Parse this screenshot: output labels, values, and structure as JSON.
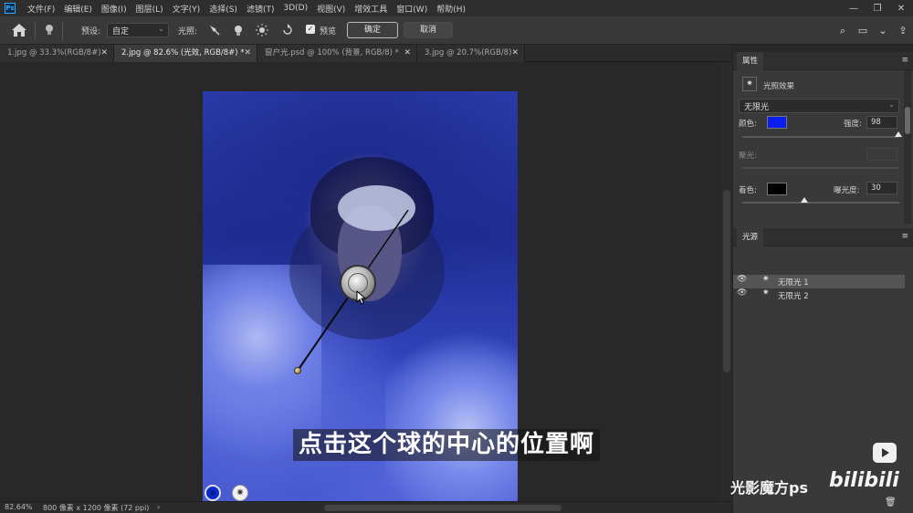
{
  "app": {
    "logo": "Ps"
  },
  "menu": [
    "文件(F)",
    "编辑(E)",
    "图像(I)",
    "图层(L)",
    "文字(Y)",
    "选择(S)",
    "滤镜(T)",
    "3D(D)",
    "视图(V)",
    "增效工具",
    "窗口(W)",
    "帮助(H)"
  ],
  "options": {
    "preset_label": "预设:",
    "preset_value": "自定",
    "light_label": "光照:",
    "preview_label": "预览",
    "preview_checked": true,
    "ok": "确定",
    "cancel": "取消"
  },
  "tabs": [
    {
      "label": "1.jpg @ 33.3%(RGB/8#)",
      "active": false
    },
    {
      "label": "2.jpg @ 82.6% (光效, RGB/8#) *",
      "active": true
    },
    {
      "label": "窗户光.psd @ 100% (背景, RGB/8) *",
      "active": false
    },
    {
      "label": "3.jpg @ 20.7%(RGB/8)",
      "active": false
    }
  ],
  "properties": {
    "tab": "属性",
    "effect_title": "光照效果",
    "light_type": "无限光",
    "color_label": "颜色:",
    "color_value": "#0a1ef0",
    "intensity_label": "强度:",
    "intensity_value": "98",
    "intensity_slider_position": 0.98,
    "hotspot_label": "聚光:",
    "tint_label": "着色:",
    "tint_color": "#000000",
    "exposure_label": "曝光度:",
    "exposure_value": "30",
    "exposure_slider_position": 0.5
  },
  "lights": {
    "tab": "光源",
    "items": [
      {
        "name": "无限光 1",
        "selected": true
      },
      {
        "name": "无限光 2",
        "selected": false
      }
    ]
  },
  "canvas": {
    "subtitle": "点击这个球的中心的位置啊",
    "swatch_color": "#0a2ad0"
  },
  "status": {
    "zoom": "82.64%",
    "doc_info": "800 像素 x 1200 像素 (72 ppi)"
  },
  "watermark": {
    "channel": "光影魔方ps",
    "site": "bilibili"
  }
}
